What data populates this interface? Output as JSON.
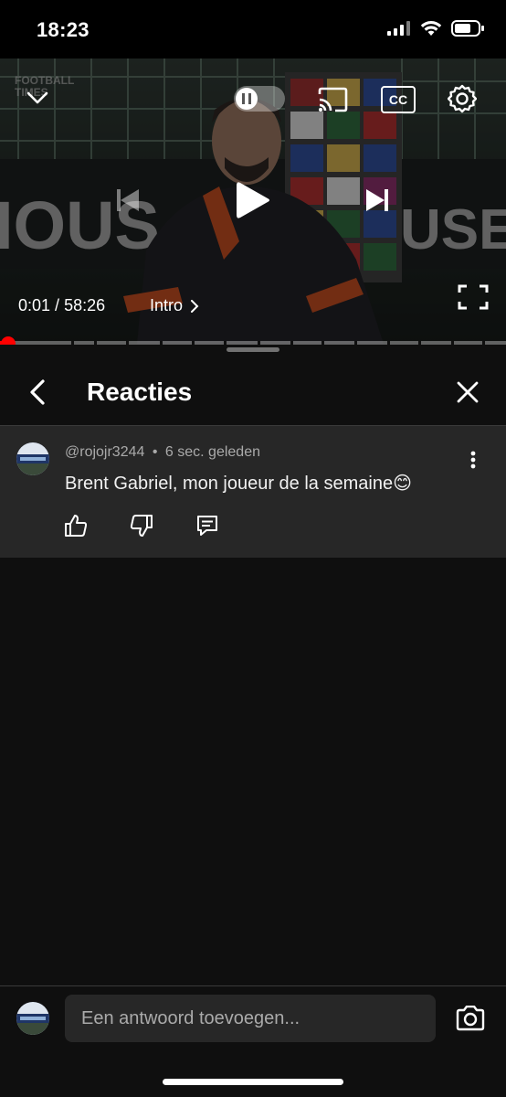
{
  "status_bar": {
    "time": "18:23",
    "icons": [
      "cellular-signal-icon",
      "wifi-icon",
      "battery-icon"
    ]
  },
  "video": {
    "current_time": "0:01",
    "duration": "58:26",
    "time_separator": " / ",
    "chapter": "Intro",
    "chapter_icon": "chevron-right-icon",
    "progress_fraction": 0.0003,
    "watermark_line1": "FOOTBALL",
    "watermark_line2": "TIMES",
    "backdrop_text_left": "IOUS",
    "backdrop_text_right": "USE",
    "controls": [
      "minimize-chevron-icon",
      "autoplay-toggle",
      "cast-icon",
      "captions-icon",
      "settings-gear-icon",
      "previous-icon",
      "play-icon",
      "next-icon",
      "fullscreen-icon"
    ],
    "captions_label": "CC"
  },
  "panel": {
    "title": "Reacties",
    "back_icon": "back-chevron-icon",
    "close_icon": "close-icon"
  },
  "comment": {
    "author": "@rojojr3244",
    "separator": "•",
    "age": "6 sec. geleden",
    "text": "Brent Gabriel, mon joueur de la semaine😊",
    "actions": [
      "like-icon",
      "dislike-icon",
      "reply-icon"
    ],
    "menu_icon": "more-vertical-icon"
  },
  "reply_bar": {
    "placeholder": "Een antwoord toevoegen...",
    "camera_icon": "camera-icon"
  },
  "colors": {
    "background": "#0f0f0f",
    "comment_bg": "#272727",
    "progress": "#ff0000",
    "secondary_text": "#aaaaaa"
  }
}
